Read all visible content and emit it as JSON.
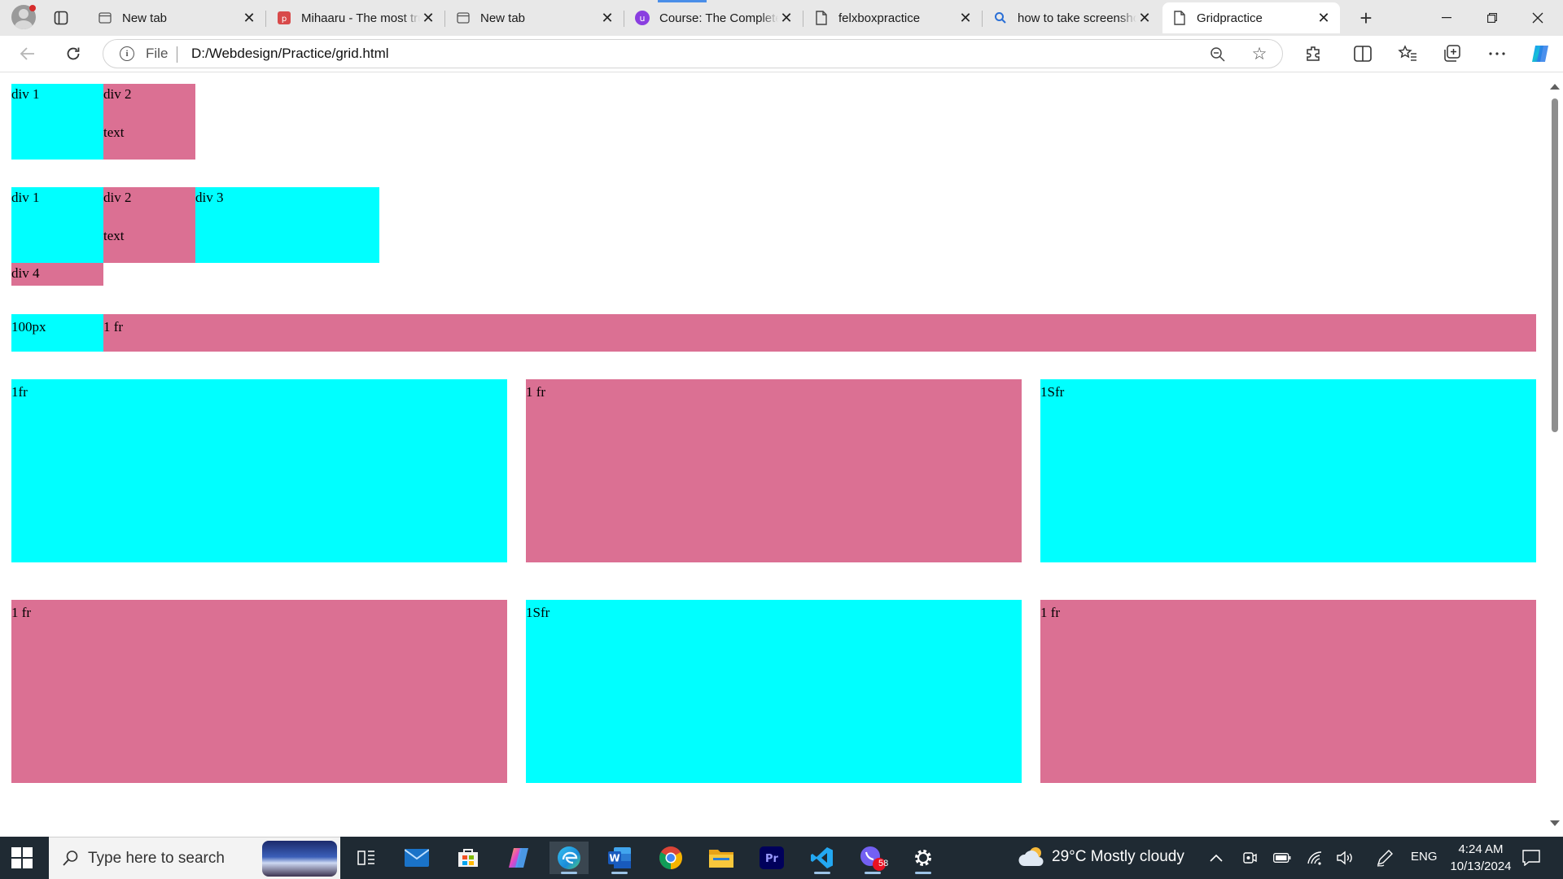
{
  "browser": {
    "tabs": [
      {
        "title": "New tab",
        "favicon": "newtab-icon",
        "active": false
      },
      {
        "title": "Mihaaru - The most trusted",
        "favicon": "mihaaru-icon",
        "active": false
      },
      {
        "title": "New tab",
        "favicon": "newtab-icon",
        "active": false
      },
      {
        "title": "Course: The Complete Web",
        "favicon": "udemy-icon",
        "active": false
      },
      {
        "title": "felxboxpractice",
        "favicon": "document-icon",
        "active": false
      },
      {
        "title": "how to take screenshot",
        "favicon": "search-icon",
        "active": false
      },
      {
        "title": "Gridpractice",
        "favicon": "document-icon",
        "active": true
      }
    ],
    "address": {
      "scheme_label": "File",
      "url": "D:/Webdesign/Practice/grid.html"
    }
  },
  "page": {
    "grid1": [
      {
        "label": "div  1",
        "color": "#00ffff"
      },
      {
        "label": "div  2",
        "sub": "text",
        "color": "#db7093"
      }
    ],
    "grid2": [
      {
        "label": "div  1",
        "color": "#00ffff"
      },
      {
        "label": "div  2",
        "sub": "text",
        "color": "#db7093"
      },
      {
        "label": "div  3",
        "color": "#00ffff"
      },
      {
        "label": "div  4",
        "color": "#db7093"
      }
    ],
    "grid3": [
      {
        "label": "100px",
        "color": "#00ffff"
      },
      {
        "label": "1  fr",
        "color": "#db7093"
      }
    ],
    "grid4": [
      {
        "label": "1fr",
        "color": "#00ffff"
      },
      {
        "label": "1  fr",
        "color": "#db7093"
      },
      {
        "label": "1Sfr",
        "color": "#00ffff"
      },
      {
        "label": "1  fr",
        "color": "#db7093"
      },
      {
        "label": "1Sfr",
        "color": "#00ffff"
      },
      {
        "label": "1  fr",
        "color": "#db7093"
      }
    ]
  },
  "taskbar": {
    "search_placeholder": "Type here to search",
    "apps": [
      "task-view-icon",
      "mail-icon",
      "store-icon",
      "copilot-icon",
      "edge-icon",
      "word-icon",
      "chrome-icon",
      "file-explorer-icon",
      "premiere-icon",
      "vscode-icon",
      "viber-icon",
      "settings-icon"
    ],
    "viber_badge": "58",
    "weather": "29°C  Mostly cloudy",
    "language": "ENG",
    "time": "4:24 AM",
    "date": "10/13/2024"
  }
}
